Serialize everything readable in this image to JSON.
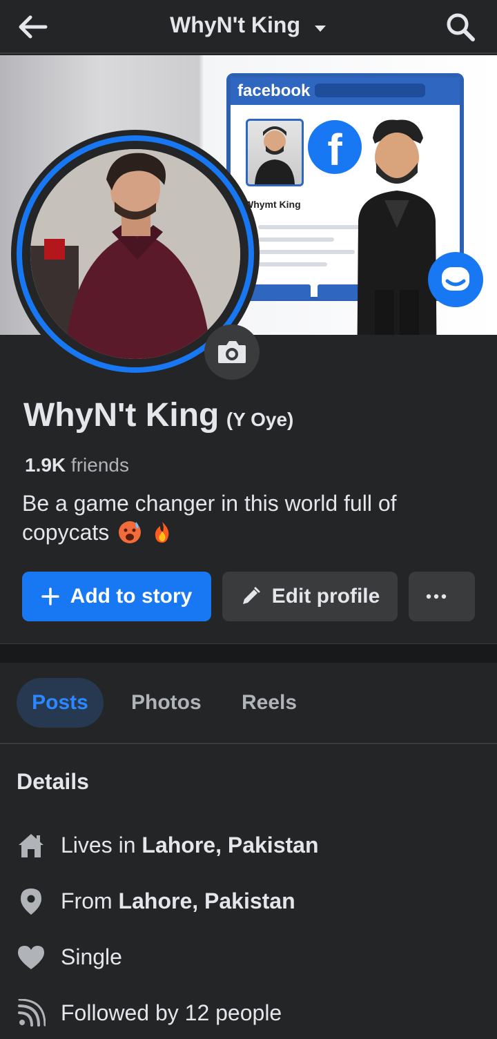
{
  "header": {
    "title": "WhyN't King",
    "back_icon": "arrow-left-icon",
    "search_icon": "search-icon"
  },
  "cover": {
    "fb_logo_text": "facebook",
    "fb_profile_name": "Whymt King",
    "fb_letter": "f"
  },
  "profile": {
    "name": "WhyN't King",
    "alt_name": "(Y Oye)",
    "friends_count": "1.9K",
    "friends_label": " friends",
    "bio": "Be a game changer in this world full of copycats"
  },
  "actions": {
    "add_story": "Add to story",
    "edit_profile": "Edit profile"
  },
  "tabs": [
    "Posts",
    "Photos",
    "Reels"
  ],
  "details": {
    "title": "Details",
    "items": [
      {
        "prefix": "Lives in ",
        "value": "Lahore, Pakistan",
        "icon": "home-icon"
      },
      {
        "prefix": "From ",
        "value": "Lahore, Pakistan",
        "icon": "location-pin-icon"
      },
      {
        "prefix": "Single",
        "value": "",
        "icon": "heart-icon"
      },
      {
        "prefix": "Followed by 12 people",
        "value": "",
        "icon": "rss-feed-icon"
      }
    ]
  },
  "colors": {
    "accent": "#1877f2",
    "background": "#242526",
    "button_gray": "#3a3b3c",
    "active_tab_bg": "#263951",
    "active_tab_text": "#2d88ff"
  }
}
